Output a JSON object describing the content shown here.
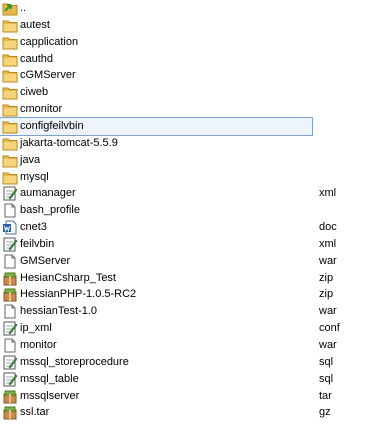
{
  "items": [
    {
      "name": "..",
      "ext": "",
      "icon": "parent-folder-icon"
    },
    {
      "name": "autest",
      "ext": "",
      "icon": "folder-icon"
    },
    {
      "name": "capplication",
      "ext": "",
      "icon": "folder-icon"
    },
    {
      "name": "cauthd",
      "ext": "",
      "icon": "folder-icon"
    },
    {
      "name": "cGMServer",
      "ext": "",
      "icon": "folder-icon"
    },
    {
      "name": "ciweb",
      "ext": "",
      "icon": "folder-icon"
    },
    {
      "name": "cmonitor",
      "ext": "",
      "icon": "folder-icon"
    },
    {
      "name": "configfeilvbin",
      "ext": "",
      "icon": "folder-icon",
      "selected": true
    },
    {
      "name": "jakarta-tomcat-5.5.9",
      "ext": "",
      "icon": "folder-icon"
    },
    {
      "name": "java",
      "ext": "",
      "icon": "folder-icon"
    },
    {
      "name": "mysql",
      "ext": "",
      "icon": "folder-icon"
    },
    {
      "name": "aumanager",
      "ext": "xml",
      "icon": "notepad-file-icon"
    },
    {
      "name": "bash_profile",
      "ext": "",
      "icon": "blank-file-icon"
    },
    {
      "name": "cnet3",
      "ext": "doc",
      "icon": "word-document-icon"
    },
    {
      "name": "feilvbin",
      "ext": "xml",
      "icon": "notepad-file-icon"
    },
    {
      "name": "GMServer",
      "ext": "war",
      "icon": "blank-file-icon"
    },
    {
      "name": "HesianCsharp_Test",
      "ext": "zip",
      "icon": "archive-icon"
    },
    {
      "name": "HessianPHP-1.0.5-RC2",
      "ext": "zip",
      "icon": "archive-icon"
    },
    {
      "name": "hessianTest-1.0",
      "ext": "war",
      "icon": "blank-file-icon"
    },
    {
      "name": "ip_xml",
      "ext": "conf",
      "icon": "notepad-file-icon"
    },
    {
      "name": "monitor",
      "ext": "war",
      "icon": "blank-file-icon"
    },
    {
      "name": "mssql_storeprocedure",
      "ext": "sql",
      "icon": "notepad-file-icon"
    },
    {
      "name": "mssql_table",
      "ext": "sql",
      "icon": "notepad-file-icon"
    },
    {
      "name": "mssqlserver",
      "ext": "tar",
      "icon": "archive-icon"
    },
    {
      "name": "ssl.tar",
      "ext": "gz",
      "icon": "archive-icon"
    }
  ]
}
